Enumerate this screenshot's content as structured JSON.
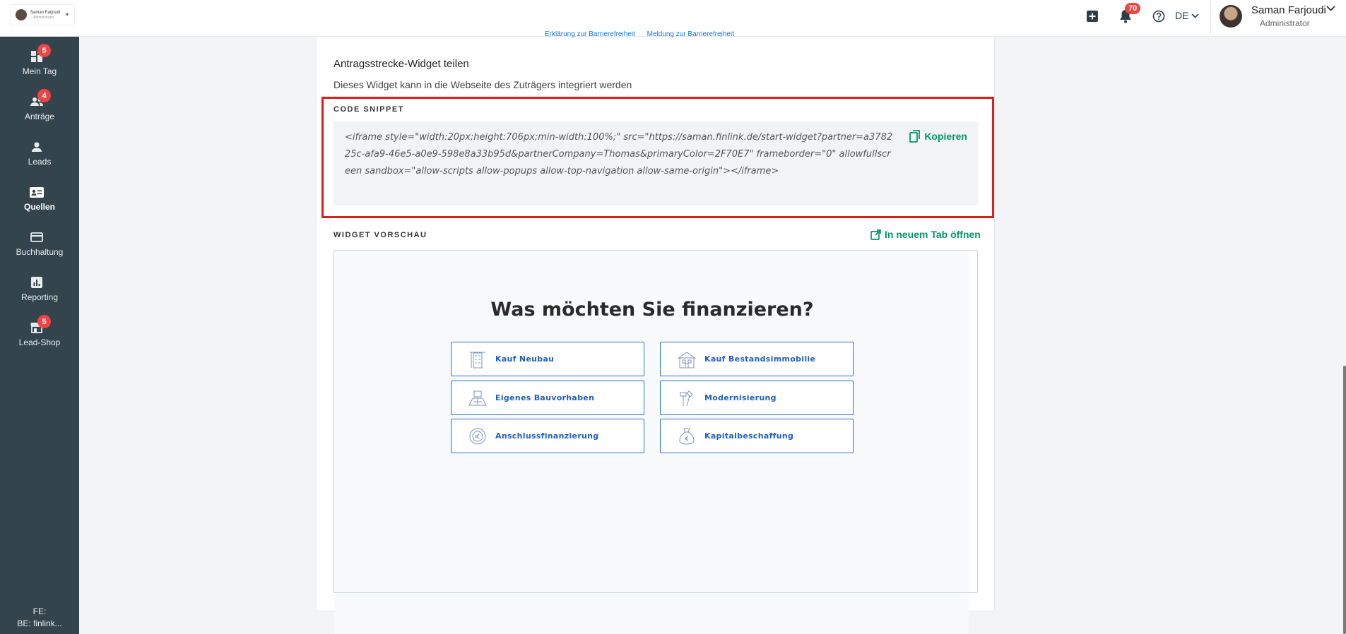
{
  "topbar": {
    "company_name": "Saman Farjoudi",
    "company_role": "Administrator",
    "notifications_count": "70",
    "language": "DE",
    "user_name": "Saman Farjoudi",
    "user_role": "Administrator"
  },
  "sidebar": {
    "items": [
      {
        "label": "Mein Tag",
        "badge": "5",
        "icon": "dashboard-icon"
      },
      {
        "label": "Anträge",
        "badge": "4",
        "icon": "users-icon"
      },
      {
        "label": "Leads",
        "badge": "",
        "icon": "person-icon"
      },
      {
        "label": "Quellen",
        "badge": "",
        "icon": "id-card-icon",
        "active": true
      },
      {
        "label": "Buchhaltung",
        "badge": "",
        "icon": "credit-card-icon"
      },
      {
        "label": "Reporting",
        "badge": "",
        "icon": "chart-icon"
      },
      {
        "label": "Lead-Shop",
        "badge": "5",
        "icon": "shop-icon"
      }
    ],
    "footer_line1": "FE:",
    "footer_line2": "BE: finlink..."
  },
  "main": {
    "top_links": [
      "Erklärung zur Barrierefreiheit",
      "Meldung zur Barrierefreiheit"
    ],
    "section_title": "Antragsstrecke-Widget teilen",
    "section_subtitle": "Dieses Widget kann in die Webseite des Zuträgers integriert werden",
    "code_label": "CODE SNIPPET",
    "code_snippet": "<iframe style=\"width:20px;height:706px;min-width:100%;\" src=\"https://saman.finlink.de/start-widget?partner=a378225c-afa9-46e5-a0e9-598e8a33b95d&partnerCompany=Thomas&primaryColor=2F70E7\" frameborder=\"0\" allowfullscreen sandbox=\"allow-scripts allow-popups allow-top-navigation allow-same-origin\"></iframe>",
    "copy_label": "Kopieren",
    "preview_label": "WIDGET VORSCHAU",
    "open_tab_label": "In neuem Tab öffnen"
  },
  "widget": {
    "title": "Was möchten Sie finanzieren?",
    "options": [
      {
        "label": "Kauf Neubau",
        "icon": "building-crane-icon"
      },
      {
        "label": "Kauf Bestandsimmobilie",
        "icon": "house-icon"
      },
      {
        "label": "Eigenes Bauvorhaben",
        "icon": "blueprint-icon"
      },
      {
        "label": "Modernisierung",
        "icon": "tools-icon"
      },
      {
        "label": "Anschlussfinanzierung",
        "icon": "euro-cycle-icon"
      },
      {
        "label": "Kapitalbeschaffung",
        "icon": "money-bag-icon"
      }
    ]
  },
  "colors": {
    "sidebar_bg": "#34444d",
    "accent_green": "#059669",
    "widget_blue": "#1e5fc4",
    "highlight_red": "#e21c1c",
    "badge_red": "#ef4444"
  }
}
